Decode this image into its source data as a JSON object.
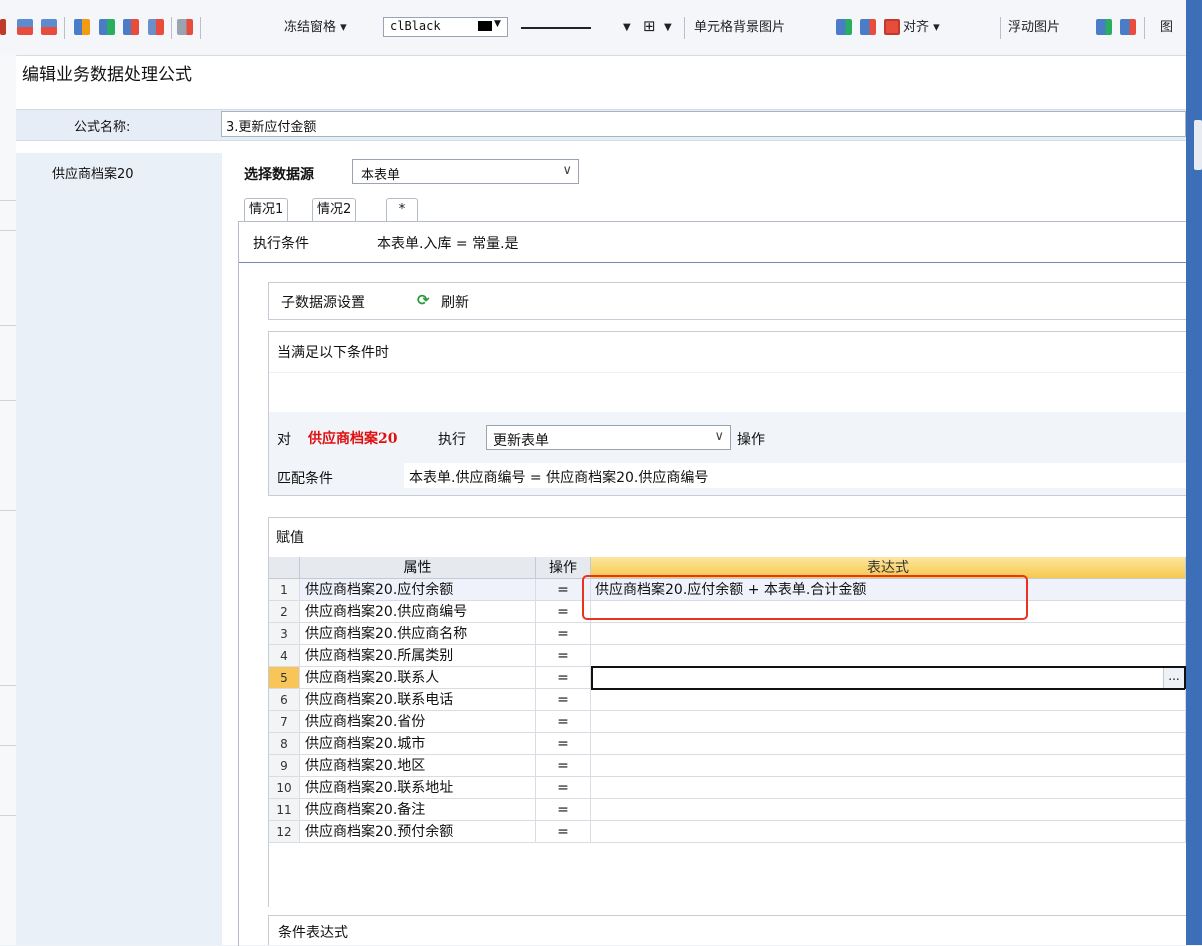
{
  "toolbar": {
    "freeze_label": "冻结窗格",
    "color_value": "clBlack",
    "cell_bg_label": "单元格背景图片",
    "align_label": "对齐",
    "float_image_label": "浮动图片",
    "trailing_label": "图"
  },
  "dialog": {
    "title": "编辑业务数据处理公式",
    "formula_name_label": "公式名称:",
    "formula_name_value": "3.更新应付金额",
    "side_item": "供应商档案20"
  },
  "datasource": {
    "label": "选择数据源",
    "value": "本表单"
  },
  "tabs": [
    "情况1",
    "情况2",
    "*"
  ],
  "condition": {
    "label": "执行条件",
    "value": "本表单.入库 = 常量.是"
  },
  "sub_source": {
    "label": "子数据源设置",
    "refresh_label": "刷新"
  },
  "when": {
    "label": "当满足以下条件时",
    "op_prefix": "对",
    "op_target": "供应商档案20",
    "op_exec": "执行",
    "op_action": "更新表单",
    "op_suffix": "操作",
    "match_label": "匹配条件",
    "match_value": "本表单.供应商编号 = 供应商档案20.供应商编号"
  },
  "assign": {
    "label": "赋值",
    "columns": [
      "属性",
      "操作",
      "表达式"
    ],
    "rows": [
      {
        "num": "1",
        "prop": "供应商档案20.应付余额",
        "op": "=",
        "expr": "供应商档案20.应付余额 + 本表单.合计金额"
      },
      {
        "num": "2",
        "prop": "供应商档案20.供应商编号",
        "op": "=",
        "expr": ""
      },
      {
        "num": "3",
        "prop": "供应商档案20.供应商名称",
        "op": "=",
        "expr": ""
      },
      {
        "num": "4",
        "prop": "供应商档案20.所属类别",
        "op": "=",
        "expr": ""
      },
      {
        "num": "5",
        "prop": "供应商档案20.联系人",
        "op": "=",
        "expr": ""
      },
      {
        "num": "6",
        "prop": "供应商档案20.联系电话",
        "op": "=",
        "expr": ""
      },
      {
        "num": "7",
        "prop": "供应商档案20.省份",
        "op": "=",
        "expr": ""
      },
      {
        "num": "8",
        "prop": "供应商档案20.城市",
        "op": "=",
        "expr": ""
      },
      {
        "num": "9",
        "prop": "供应商档案20.地区",
        "op": "=",
        "expr": ""
      },
      {
        "num": "10",
        "prop": "供应商档案20.联系地址",
        "op": "=",
        "expr": ""
      },
      {
        "num": "11",
        "prop": "供应商档案20.备注",
        "op": "=",
        "expr": ""
      },
      {
        "num": "12",
        "prop": "供应商档案20.预付余额",
        "op": "=",
        "expr": ""
      }
    ],
    "editor_button": "..."
  },
  "cond_expr": {
    "label": "条件表达式"
  }
}
